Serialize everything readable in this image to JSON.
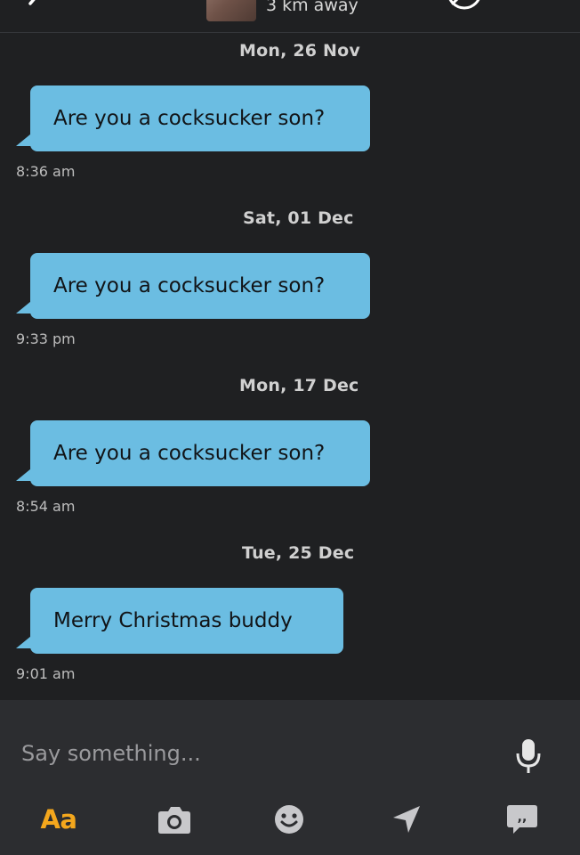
{
  "header": {
    "distance": "3 km away",
    "back_icon": "chevron-left-icon",
    "block_icon": "block-icon"
  },
  "messages": [
    {
      "date": "Mon, 26 Nov",
      "text": "Are you a cocksucker son?",
      "time": "8:36 am"
    },
    {
      "date": "Sat, 01 Dec",
      "text": "Are you a cocksucker son?",
      "time": "9:33 pm"
    },
    {
      "date": "Mon, 17 Dec",
      "text": "Are you a cocksucker son?",
      "time": "8:54 am"
    },
    {
      "date": "Tue, 25 Dec",
      "text": "Merry Christmas buddy",
      "time": "9:01 am"
    }
  ],
  "composer": {
    "placeholder": "Say something...",
    "font_button_label": "Aa",
    "icons": [
      "microphone-icon",
      "camera-icon",
      "smiley-icon",
      "location-arrow-icon",
      "saved-phrases-icon"
    ]
  },
  "colors": {
    "background": "#1f2022",
    "bubble": "#6bbde2",
    "composer": "#2c2d30",
    "accent": "#f4a71d"
  }
}
